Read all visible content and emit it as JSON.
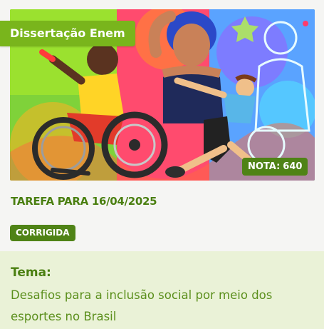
{
  "card": {
    "category": "Dissertação Enem",
    "score_label": "NOTA:",
    "score_value": "640",
    "task_date": "TAREFA PARA 16/04/2025",
    "status": "CORRIGIDA",
    "theme_label": "Tema:",
    "theme_text": "Desafios para a inclusão social por meio dos esportes no Brasil"
  },
  "image": {
    "subject": "illustration of athletes including a wheelchair user and a runner"
  },
  "colors": {
    "accent": "#79b51c",
    "badge_dark": "#4f8316",
    "text_green": "#4a7f10",
    "theme_bg": "#eaf2d7",
    "page_bg": "#f5f5f3"
  }
}
